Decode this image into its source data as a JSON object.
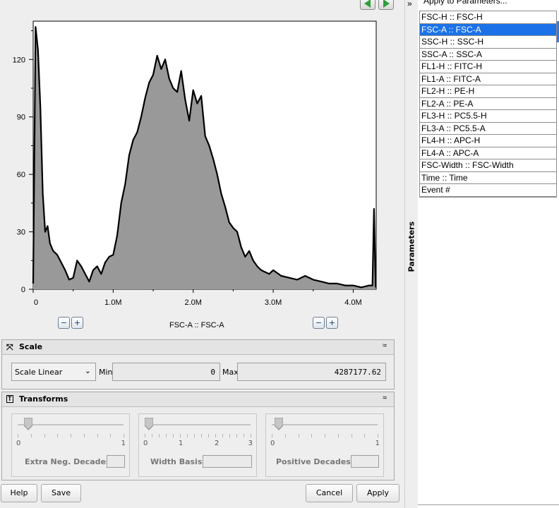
{
  "chart_data": {
    "type": "area",
    "title": "",
    "xlabel": "FSC-A :: FSC-A",
    "ylabel": "",
    "xlim": [
      0,
      4287177.62
    ],
    "ylim": [
      0,
      140
    ],
    "x_ticks": [
      {
        "value": 0,
        "label": "0"
      },
      {
        "value": 1000000,
        "label": "1.0M"
      },
      {
        "value": 2000000,
        "label": "2.0M"
      },
      {
        "value": 3000000,
        "label": "3.0M"
      },
      {
        "value": 4000000,
        "label": "4.0M"
      }
    ],
    "y_ticks": [
      {
        "value": 0,
        "label": "0"
      },
      {
        "value": 30,
        "label": "30"
      },
      {
        "value": 60,
        "label": "60"
      },
      {
        "value": 90,
        "label": "90"
      },
      {
        "value": 120,
        "label": "120"
      }
    ],
    "grid": false,
    "series": [
      {
        "x": [
          0,
          30000,
          60000,
          90000,
          120000,
          150000,
          180000,
          210000,
          250000,
          300000,
          350000,
          400000,
          450000,
          500000,
          550000,
          600000,
          650000,
          700000,
          750000,
          800000,
          850000,
          900000,
          950000,
          1000000,
          1050000,
          1100000,
          1150000,
          1200000,
          1250000,
          1300000,
          1350000,
          1400000,
          1450000,
          1500000,
          1550000,
          1600000,
          1650000,
          1700000,
          1750000,
          1800000,
          1850000,
          1900000,
          1950000,
          2000000,
          2050000,
          2100000,
          2150000,
          2200000,
          2250000,
          2300000,
          2350000,
          2400000,
          2450000,
          2500000,
          2550000,
          2600000,
          2650000,
          2700000,
          2750000,
          2800000,
          2850000,
          2900000,
          2950000,
          3000000,
          3100000,
          3200000,
          3300000,
          3400000,
          3500000,
          3600000,
          3700000,
          3800000,
          3900000,
          4000000,
          4100000,
          4200000,
          4240000,
          4260000,
          4280000
        ],
        "y": [
          3,
          137,
          125,
          95,
          50,
          30,
          33,
          24,
          20,
          18,
          14,
          10,
          5,
          6,
          15,
          12,
          8,
          4,
          10,
          12,
          8,
          14,
          17,
          18,
          28,
          45,
          55,
          70,
          78,
          82,
          90,
          100,
          108,
          112,
          122,
          115,
          120,
          110,
          105,
          103,
          114,
          99,
          88,
          104,
          97,
          101,
          80,
          75,
          68,
          60,
          50,
          43,
          35,
          32,
          30,
          22,
          17,
          20,
          15,
          12,
          10,
          9,
          8,
          10,
          7,
          6,
          5,
          7,
          5,
          4,
          3,
          3,
          2,
          2,
          1,
          2,
          2,
          42,
          1
        ]
      }
    ]
  },
  "plot": {
    "x_param_label": "FSC-A :: FSC-A",
    "zoom_minus": "−",
    "zoom_plus": "+"
  },
  "scale_panel": {
    "title": "Scale",
    "collapse_glyph": "≈",
    "scale_select_value": "Scale Linear",
    "min_label": "Min",
    "min_value": "0",
    "max_label": "Max",
    "max_value": "4287177.62"
  },
  "transforms_panel": {
    "title": "Transforms",
    "collapse_glyph": "≈",
    "sliders": [
      {
        "label": "Extra Neg. Decades",
        "min": "0",
        "max": "1",
        "value": 0
      },
      {
        "label": "Width Basis",
        "ticks": [
          "0",
          "1",
          "2",
          "3"
        ],
        "value": 0
      },
      {
        "label": "Positive Decades",
        "min": "0",
        "max": "1",
        "value": 0
      }
    ]
  },
  "buttons": {
    "help": "Help",
    "save": "Save",
    "cancel": "Cancel",
    "apply": "Apply"
  },
  "side_panel": {
    "tab_label": "Parameters",
    "expand_glyph": "»",
    "apply_to_params": "Apply to Parameters...",
    "parameters": [
      "FSC-H :: FSC-H",
      "FSC-A :: FSC-A",
      "SSC-H :: SSC-H",
      "SSC-A :: SSC-A",
      "FL1-H :: FITC-H",
      "FL1-A :: FITC-A",
      "FL2-H :: PE-H",
      "FL2-A :: PE-A",
      "FL3-H :: PC5.5-H",
      "FL3-A :: PC5.5-A",
      "FL4-H :: APC-H",
      "FL4-A :: APC-A",
      "FSC-Width :: FSC-Width",
      "Time :: Time",
      "Event #"
    ],
    "selected_index": 1
  },
  "colors": {
    "histogram_fill": "#999999",
    "histogram_line": "#000000",
    "selection": "#1b72e8",
    "nav_arrow": "#2e9e3c"
  }
}
